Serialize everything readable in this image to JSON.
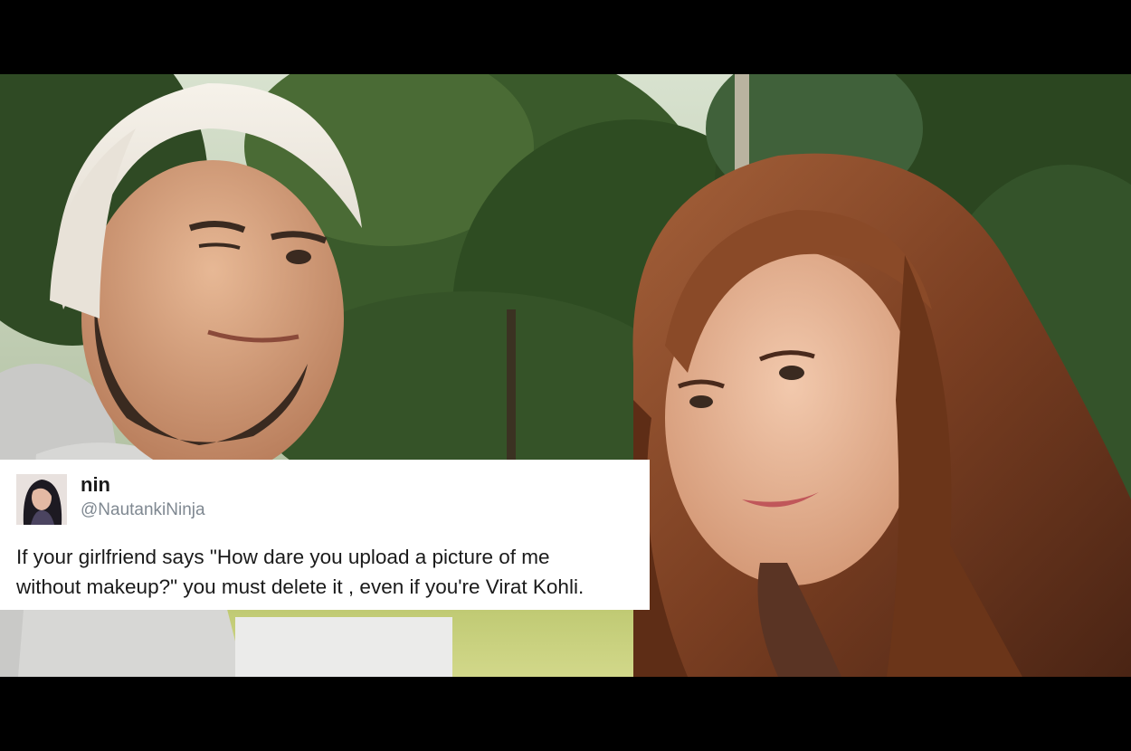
{
  "tweet": {
    "name": "nin",
    "handle": "@NautankiNinja",
    "text_lines": [
      "If your girlfriend says \"How dare you upload a picture of me",
      "without makeup?\" you must delete it , even if you're Virat Kohli."
    ]
  },
  "image": {
    "subjects": [
      "man-in-white-beanie",
      "woman-with-long-hair"
    ],
    "background": "trees-and-grass"
  },
  "colors": {
    "frame": "#000000",
    "card_background": "#ffffff",
    "name_text": "#1a1a1a",
    "handle_text": "#7f8891",
    "foliage": "#3c5a2c",
    "hair": "#8a4a2a",
    "skin": "#e2b294"
  }
}
